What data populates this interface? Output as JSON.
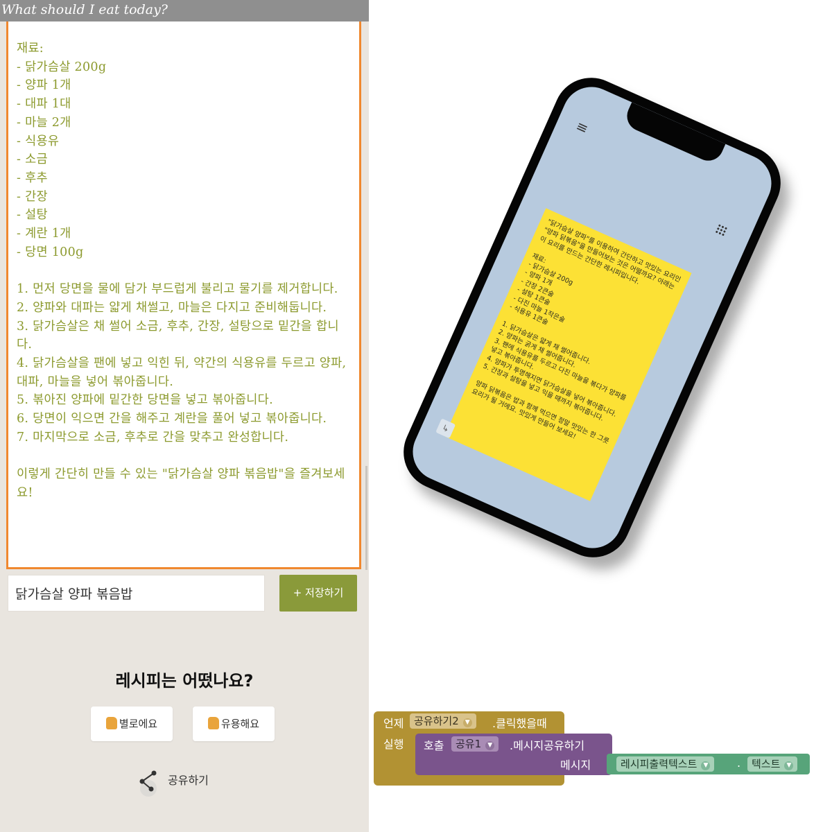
{
  "app": {
    "title": "What should I eat today?",
    "recipe_text": "재료:\n- 닭가슴살 200g\n- 양파 1개\n- 대파 1대\n- 마늘 2개\n- 식용유\n- 소금\n- 후추\n- 간장\n- 설탕\n- 계란 1개\n- 당면 100g\n\n1. 먼저 당면을 물에 담가 부드럽게 불리고 물기를 제거합니다.\n2. 양파와 대파는 얇게 채썰고, 마늘은 다지고 준비해둡니다.\n3. 닭가슴살은 채 썰어 소금, 후추, 간장, 설탕으로 밑간을 합니다.\n4. 닭가슴살을 팬에 넣고 익힌 뒤, 약간의 식용유를 두르고 양파, 대파, 마늘을 넣어 볶아줍니다.\n5. 볶아진 양파에 밑간한 당면을 넣고 볶아줍니다.\n6. 당면이 익으면 간을 해주고 계란을 풀어 넣고 볶아줍니다.\n7. 마지막으로 소금, 후추로 간을 맞추고 완성합니다.\n\n이렇게 간단히 만들 수 있는 \"닭가슴살 양파 볶음밥\"을 즐겨보세요!",
    "title_input_value": "닭가슴살 양파 볶음밥",
    "save_label": "+ 저장하기",
    "question": "레시피는 어떴나요?",
    "rate_bad": "별로에요",
    "rate_good": "유용해요",
    "share_label": "공유하기",
    "accent": "#f0882e",
    "text_color": "#8c9a2e",
    "save_color": "#8a9a3a"
  },
  "phone": {
    "message_text": "\"닭가슴살 양파\"를 이용하여 간단하고 맛있는 요리인 \"양파 닭볶음\"을 만들어보는 것은 어떨까요? 아래는 이 요리를 만드는 간단한 레시피입니다.\n\n재료:\n- 닭가슴살 200g\n- 양파 1개\n- 간장 2큰술\n- 설탕 1큰술\n- 다진 마늘 1작은술\n- 식용유 1큰술\n\n1. 닭가슴살은 얇게 채 썰어줍니다.\n2. 양파는 굵게 채 썰어줍니다.\n3. 팬에 식용유를 두르고 다진 마늘을 볶다가 양파를 넣고 볶아줍니다.\n4. 양파가 투명해지면 닭가슴살을 넣어 볶아줍니다.\n5. 간장과 설탕을 넣고 익을 때까지 볶아줍니다.\n\n양파 닭볶음은 밥과 함께 먹으면 정말 맛있는 한 그릇 요리가 될 거에요. 맛있게 만들어 보세요!",
    "menu_icon": "hamburger-menu-icon",
    "grid_icon": "dots-grid-icon",
    "bubble_color": "#fce135",
    "screen_color": "#b7cade"
  },
  "blocks": {
    "event_when": "언제",
    "event_component": "공유하기2",
    "event_name": ".클릭했을때",
    "event_do": "실행",
    "call_label": "호출",
    "call_component": "공유1",
    "call_method": ".메시지공유하기",
    "call_arg": "메시지",
    "text_component": "레시피출력텍스트",
    "text_dot": ".",
    "text_property": "텍스트"
  }
}
